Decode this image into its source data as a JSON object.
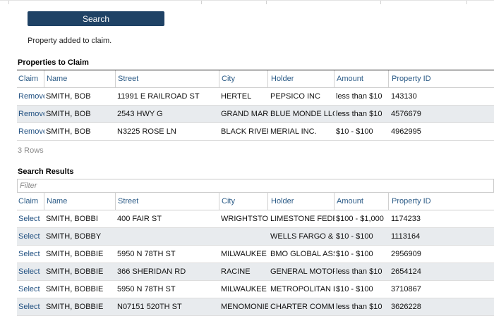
{
  "search": {
    "button_label": "Search"
  },
  "status_message": "Property added to claim.",
  "claim_table": {
    "title": "Properties to Claim",
    "headers": [
      "Claim",
      "Name",
      "Street",
      "City",
      "Holder",
      "Amount",
      "Property ID"
    ],
    "rows": [
      {
        "action": "Remove",
        "name": "SMITH, BOB",
        "street": "11991 E RAILROAD ST",
        "city": "HERTEL",
        "holder": "PEPSICO INC",
        "amount": "less than $10",
        "property_id": "143130"
      },
      {
        "action": "Remove",
        "name": "SMITH, BOB",
        "street": "2543 HWY G",
        "city": "GRAND MARSH",
        "holder": "BLUE MONDE LLC",
        "amount": "less than $10",
        "property_id": "4576679"
      },
      {
        "action": "Remove",
        "name": "SMITH, BOB",
        "street": "N3225 ROSE LN",
        "city": "BLACK RIVER FALLS",
        "holder": "MERIAL INC.",
        "amount": "$10 - $100",
        "property_id": "4962995"
      }
    ],
    "row_count_text": "3 Rows"
  },
  "results_table": {
    "title": "Search Results",
    "filter_placeholder": "Filter",
    "filter_value": "",
    "headers": [
      "Claim",
      "Name",
      "Street",
      "City",
      "Holder",
      "Amount",
      "Property ID"
    ],
    "rows": [
      {
        "action": "Select",
        "name": "SMITH, BOBBI",
        "street": "400 FAIR ST",
        "city": "WRIGHTSTOWN",
        "holder": "LIMESTONE FEDERAL",
        "amount": "$100 - $1,000",
        "property_id": "1174233"
      },
      {
        "action": "Select",
        "name": "SMITH, BOBBY",
        "street": "",
        "city": "",
        "holder": "WELLS FARGO & CO",
        "amount": "$10 - $100",
        "property_id": "1113164"
      },
      {
        "action": "Select",
        "name": "SMITH, BOBBIE",
        "street": "5950 N 78TH ST",
        "city": "MILWAUKEE",
        "holder": "BMO GLOBAL ASSET",
        "amount": "$10 - $100",
        "property_id": "2956909"
      },
      {
        "action": "Select",
        "name": "SMITH, BOBBIE",
        "street": "366 SHERIDAN RD",
        "city": "RACINE",
        "holder": "GENERAL MOTORS",
        "amount": "less than $10",
        "property_id": "2654124"
      },
      {
        "action": "Select",
        "name": "SMITH, BOBBIE",
        "street": "5950 N 78TH ST",
        "city": "MILWAUKEE",
        "holder": "METROPOLITAN LIFE",
        "amount": "$10 - $100",
        "property_id": "3710867"
      },
      {
        "action": "Select",
        "name": "SMITH, BOBBIE",
        "street": "N07151 520TH ST",
        "city": "MENOMONIE",
        "holder": "CHARTER COMMUNICATIONS",
        "amount": "less than $10",
        "property_id": "3626228"
      }
    ]
  }
}
